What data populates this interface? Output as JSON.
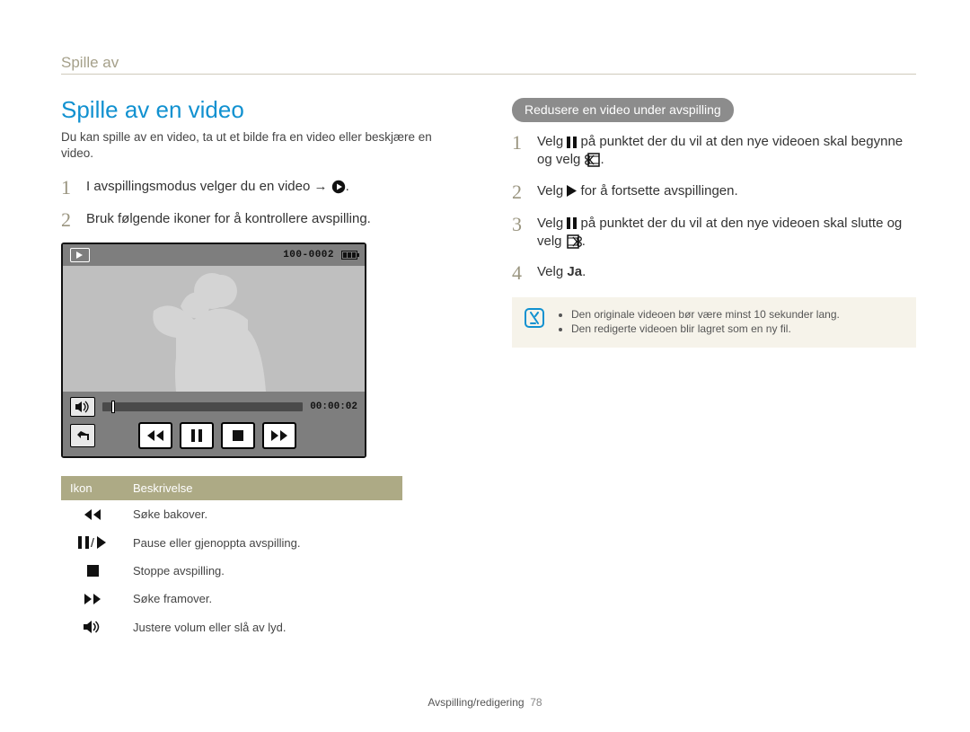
{
  "running_head": "Spille av",
  "heading": "Spille av en video",
  "lead": "Du kan spille av en video, ta ut et bilde fra en video eller beskjære en video.",
  "left_steps": [
    "I avspillingsmodus velger du en video →",
    "Bruk følgende ikoner for å kontrollere avspilling."
  ],
  "player": {
    "file_counter": "100-0002",
    "time": "00:00:02"
  },
  "icon_table": {
    "headers": [
      "Ikon",
      "Beskrivelse"
    ],
    "rows": [
      "Søke bakover.",
      "Pause eller gjenoppta avspilling.",
      "Stoppe avspilling.",
      "Søke framover.",
      "Justere volum eller slå av lyd."
    ]
  },
  "right": {
    "pill": "Redusere en video under avspilling",
    "steps": {
      "s1_a": "Velg ",
      "s1_b": " på punktet der du vil at den nye videoen skal begynne og velg ",
      "s2_a": "Velg ",
      "s2_b": " for å fortsette avspillingen.",
      "s3_a": "Velg ",
      "s3_b": " på punktet der du vil at den nye videoen skal slutte og velg ",
      "s4_a": "Velg ",
      "s4_bold": "Ja",
      "s4_b": "."
    },
    "notes": [
      "Den originale videoen bør være minst 10 sekunder lang.",
      "Den redigerte videoen blir lagret som en ny fil."
    ]
  },
  "footer": {
    "section": "Avspilling/redigering",
    "page": "78"
  }
}
